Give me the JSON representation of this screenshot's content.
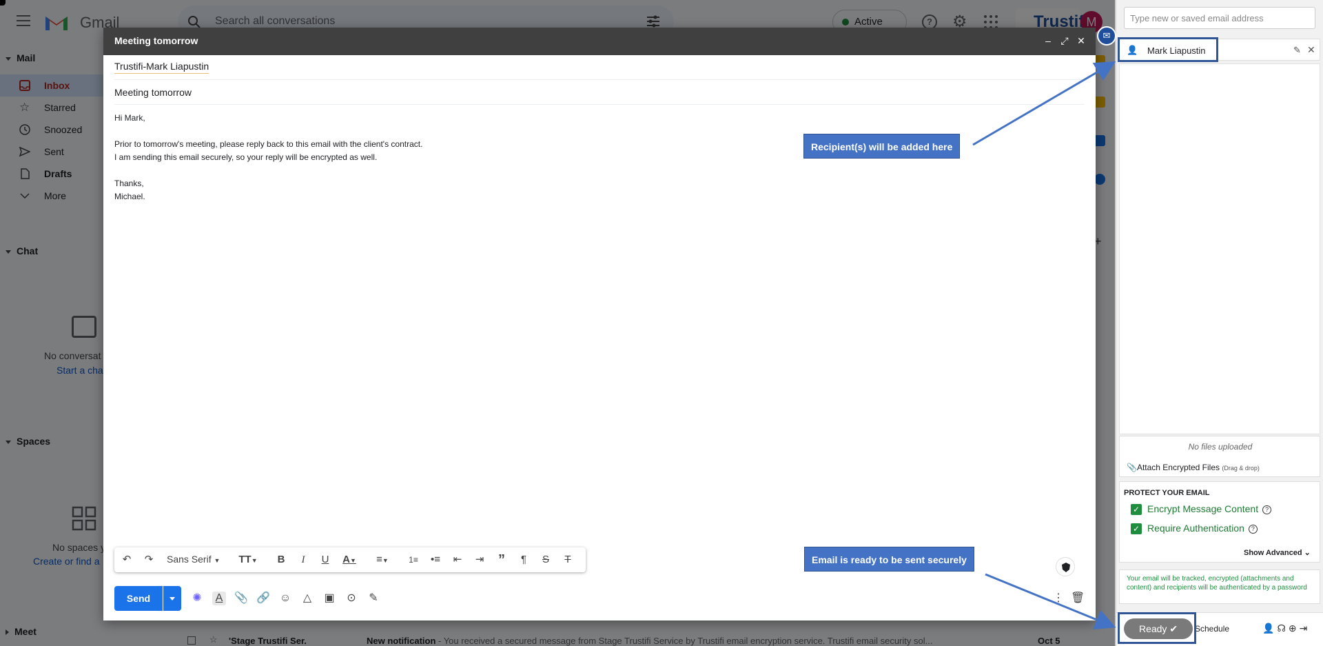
{
  "gmail": {
    "brand": "Gmail",
    "search_placeholder": "Search all conversations",
    "status": "Active",
    "avatar_letter": "M",
    "trustifi_badge": "Trustifi",
    "sections": {
      "mail": "Mail",
      "chat": "Chat",
      "spaces": "Spaces",
      "meet": "Meet"
    },
    "nav": [
      {
        "label": "Inbox",
        "icon": "inbox-icon"
      },
      {
        "label": "Starred",
        "icon": "star-icon"
      },
      {
        "label": "Snoozed",
        "icon": "clock-icon"
      },
      {
        "label": "Sent",
        "icon": "send-icon"
      },
      {
        "label": "Drafts",
        "icon": "draft-icon"
      },
      {
        "label": "More",
        "icon": "chevron-down-icon"
      }
    ],
    "chat_empty": {
      "text": "No conversat",
      "link": "Start a cha"
    },
    "spaces_empty": {
      "text": "No spaces y",
      "link": "Create or find a"
    },
    "bottom_row": {
      "sender": "'Stage Trustifi Ser.",
      "subject": "New notification",
      "snippet": " - You received a secured message from Stage Trustifi Service by Trustifi email encryption service. Trustifi email security sol...",
      "date": "Oct 5"
    }
  },
  "compose": {
    "title": "Meeting tomorrow",
    "to": "Trustifi-Mark Liapustin",
    "subject": "Meeting tomorrow",
    "body": "Hi Mark,\n\nPrior to tomorrow's meeting, please reply back to this email with the client's contract.\nI am sending this email securely, so your reply will be encrypted as well.\n\nThanks,\nMichael.",
    "font": "Sans Serif",
    "send_label": "Send"
  },
  "annotations": {
    "recipients": "Recipient(s) will be added here",
    "ready": "Email is ready to be sent securely"
  },
  "trustifi_panel": {
    "input_placeholder": "Type new or saved email address",
    "recipient": "Mark Liapustin",
    "no_files": "No files uploaded",
    "attach_label": "Attach Encrypted Files",
    "attach_hint": "(Drag & drop)",
    "protect_title": "PROTECT YOUR EMAIL",
    "options": [
      {
        "label": "Encrypt Message Content",
        "checked": true
      },
      {
        "label": "Require Authentication",
        "checked": true
      }
    ],
    "show_advanced": "Show Advanced",
    "notice": "Your email will be tracked, encrypted (attachments and content) and recipients will be authenticated by a password",
    "ready_label": "Ready",
    "schedule_label": "Schedule"
  },
  "colors": {
    "accent": "#1a73e8",
    "callout": "#4472c4",
    "trustifi_green": "#1e8e3e",
    "compose_header": "#404040"
  }
}
